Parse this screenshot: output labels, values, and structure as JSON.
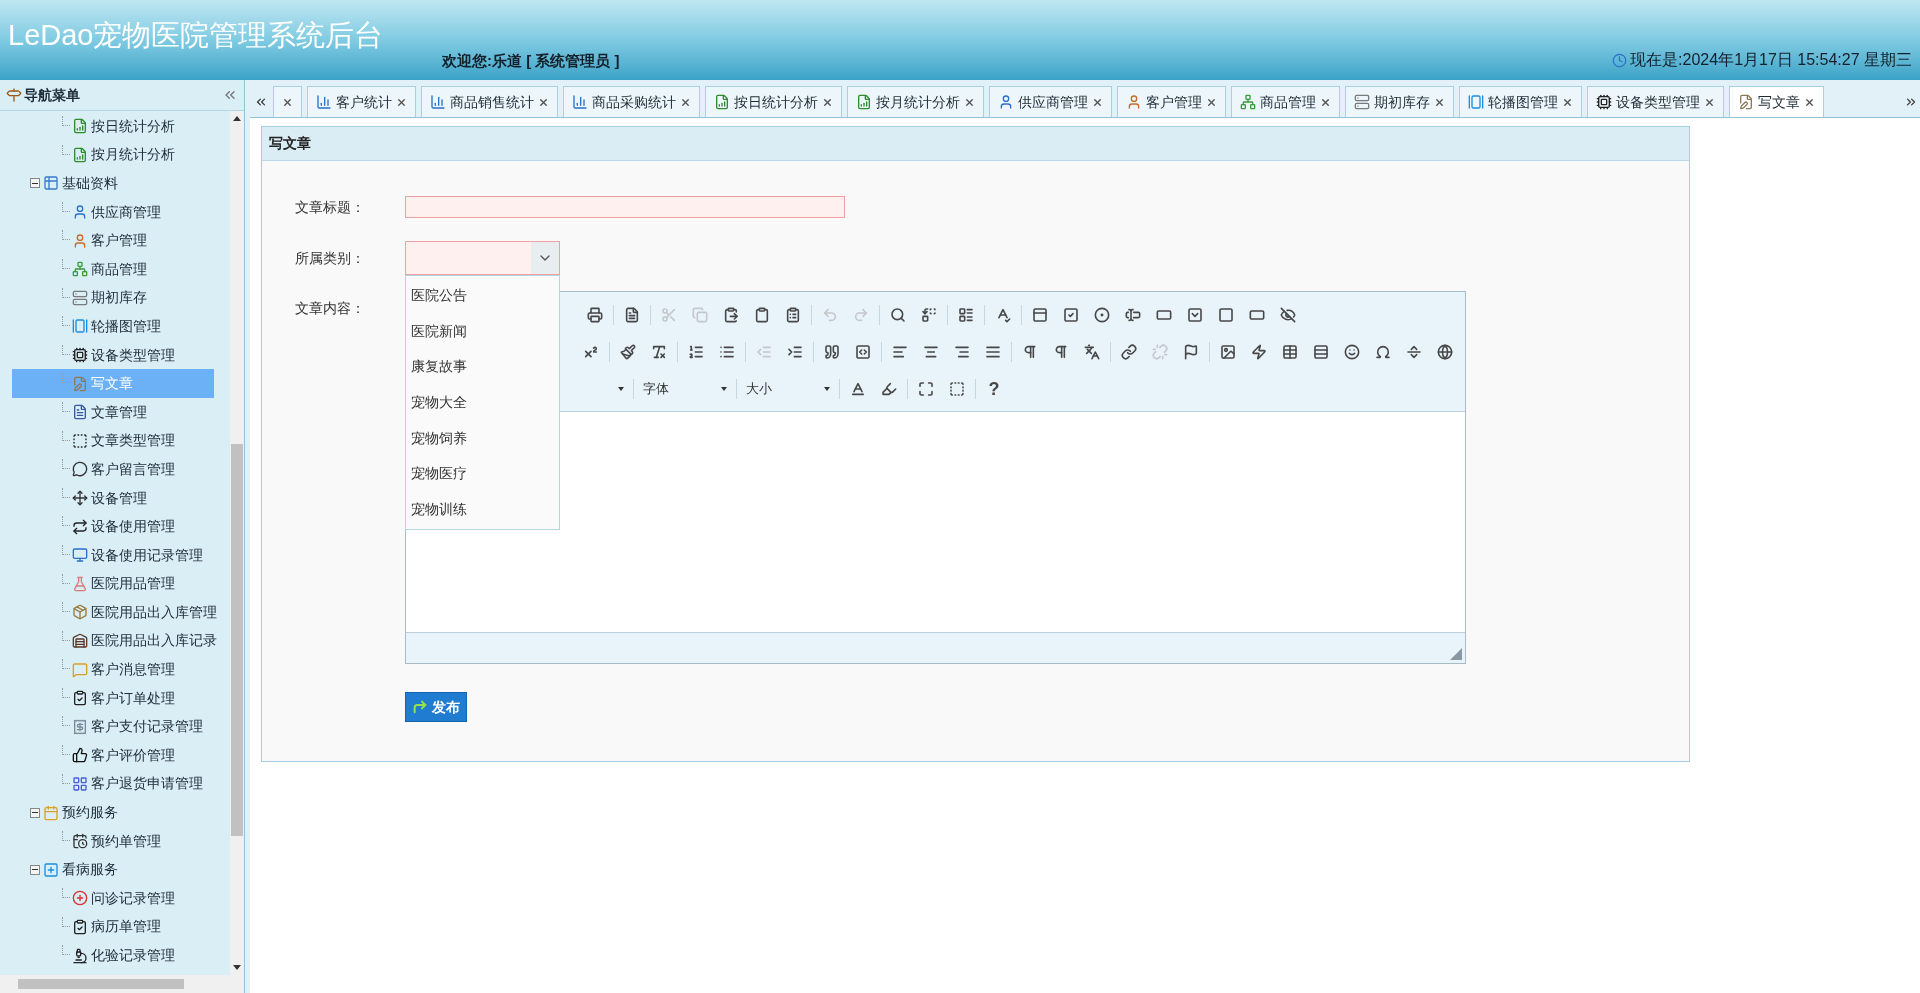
{
  "header": {
    "title": "LeDao宠物医院管理系统后台",
    "welcome": "欢迎您:乐道 [ 系统管理员 ]",
    "clock": "现在是:2024年1月17日 15:54:27 星期三"
  },
  "sidebar": {
    "title": "导航菜单",
    "items": [
      {
        "children": [
          {
            "label": "按日统计分析",
            "selected": false
          },
          {
            "label": "按月统计分析",
            "selected": false
          }
        ]
      },
      {
        "label": "基础资料",
        "expanded": true,
        "children": [
          {
            "label": "供应商管理",
            "selected": false
          },
          {
            "label": "客户管理",
            "selected": false
          },
          {
            "label": "商品管理",
            "selected": false
          },
          {
            "label": "期初库存",
            "selected": false
          },
          {
            "label": "轮播图管理",
            "selected": false
          },
          {
            "label": "设备类型管理",
            "selected": false
          },
          {
            "label": "写文章",
            "selected": true
          },
          {
            "label": "文章管理",
            "selected": false
          },
          {
            "label": "文章类型管理",
            "selected": false
          },
          {
            "label": "客户留言管理",
            "selected": false
          },
          {
            "label": "设备管理",
            "selected": false
          },
          {
            "label": "设备使用管理",
            "selected": false
          },
          {
            "label": "设备使用记录管理",
            "selected": false
          },
          {
            "label": "医院用品管理",
            "selected": false
          },
          {
            "label": "医院用品出入库管理",
            "selected": false
          },
          {
            "label": "医院用品出入库记录",
            "selected": false
          },
          {
            "label": "客户消息管理",
            "selected": false
          },
          {
            "label": "客户订单处理",
            "selected": false
          },
          {
            "label": "客户支付记录管理",
            "selected": false
          },
          {
            "label": "客户评价管理",
            "selected": false
          },
          {
            "label": "客户退货申请管理",
            "selected": false
          }
        ]
      },
      {
        "label": "预约服务",
        "expanded": true,
        "children": [
          {
            "label": "预约单管理",
            "selected": false
          }
        ]
      },
      {
        "label": "看病服务",
        "expanded": true,
        "children": [
          {
            "label": "问诊记录管理",
            "selected": false
          },
          {
            "label": "病历单管理",
            "selected": false
          },
          {
            "label": "化验记录管理",
            "selected": false
          }
        ]
      }
    ]
  },
  "tabs": [
    {
      "selected": false
    },
    {
      "label": "客户统计",
      "selected": false
    },
    {
      "label": "商品销售统计",
      "selected": false
    },
    {
      "label": "商品采购统计",
      "selected": false
    },
    {
      "label": "按日统计分析",
      "selected": false
    },
    {
      "label": "按月统计分析",
      "selected": false
    },
    {
      "label": "供应商管理",
      "selected": false
    },
    {
      "label": "客户管理",
      "selected": false
    },
    {
      "label": "商品管理",
      "selected": false
    },
    {
      "label": "期初库存",
      "selected": false
    },
    {
      "label": "轮播图管理",
      "selected": false
    },
    {
      "label": "设备类型管理",
      "selected": false
    },
    {
      "label": "写文章",
      "selected": true
    }
  ],
  "panel": {
    "title": "写文章",
    "fields": [
      {
        "kind": "text",
        "label": "文章标题：",
        "invalid": true
      },
      {
        "kind": "select",
        "label": "所属类别：",
        "invalid": true,
        "expanded": true,
        "options": [
          {
            "label": "医院公告",
            "selected": false
          },
          {
            "label": "医院新闻",
            "selected": false
          },
          {
            "label": "康复故事",
            "selected": false
          },
          {
            "label": "宠物大全",
            "selected": false
          },
          {
            "label": "宠物饲养",
            "selected": false
          },
          {
            "label": "宠物医疗",
            "selected": false
          },
          {
            "label": "宠物训练",
            "selected": false
          }
        ]
      },
      {
        "kind": "editor",
        "label": "文章内容："
      }
    ],
    "toolbar": [
      [
        {
          "kind": "button",
          "disabled": false
        },
        {
          "kind": "separator"
        },
        {
          "kind": "button",
          "disabled": false
        },
        {
          "kind": "separator"
        },
        {
          "kind": "button",
          "disabled": true
        },
        {
          "kind": "button",
          "disabled": true
        },
        {
          "kind": "button",
          "disabled": false
        },
        {
          "kind": "button",
          "disabled": false
        },
        {
          "kind": "button",
          "disabled": false
        },
        {
          "kind": "separator"
        },
        {
          "kind": "button",
          "disabled": true
        },
        {
          "kind": "button",
          "disabled": true
        },
        {
          "kind": "separator"
        },
        {
          "kind": "button",
          "disabled": false
        },
        {
          "kind": "button",
          "disabled": false
        },
        {
          "kind": "separator"
        },
        {
          "kind": "button",
          "disabled": false
        },
        {
          "kind": "separator"
        },
        {
          "kind": "button",
          "disabled": false
        },
        {
          "kind": "separator"
        },
        {
          "kind": "button",
          "disabled": false
        },
        {
          "kind": "button",
          "disabled": false
        },
        {
          "kind": "button",
          "disabled": false
        },
        {
          "kind": "button",
          "disabled": false
        },
        {
          "kind": "button",
          "disabled": false
        },
        {
          "kind": "button",
          "disabled": false
        },
        {
          "kind": "button",
          "disabled": false
        },
        {
          "kind": "button",
          "disabled": false
        },
        {
          "kind": "button",
          "disabled": false
        }
      ],
      [
        {
          "kind": "button",
          "disabled": false
        },
        {
          "kind": "separator"
        },
        {
          "kind": "button",
          "disabled": false
        },
        {
          "kind": "button",
          "disabled": false
        },
        {
          "kind": "separator"
        },
        {
          "kind": "button",
          "disabled": false
        },
        {
          "kind": "button",
          "disabled": false
        },
        {
          "kind": "separator"
        },
        {
          "kind": "button",
          "disabled": true
        },
        {
          "kind": "button",
          "disabled": false
        },
        {
          "kind": "separator"
        },
        {
          "kind": "button",
          "disabled": false
        },
        {
          "kind": "button",
          "disabled": false
        },
        {
          "kind": "separator"
        },
        {
          "kind": "button",
          "disabled": false
        },
        {
          "kind": "button",
          "disabled": false
        },
        {
          "kind": "button",
          "disabled": false
        },
        {
          "kind": "button",
          "disabled": false
        },
        {
          "kind": "separator"
        },
        {
          "kind": "button",
          "disabled": false
        },
        {
          "kind": "button",
          "disabled": false
        },
        {
          "kind": "button",
          "disabled": false
        },
        {
          "kind": "separator"
        },
        {
          "kind": "button",
          "disabled": false
        },
        {
          "kind": "button",
          "disabled": true
        },
        {
          "kind": "button",
          "disabled": false
        },
        {
          "kind": "separator"
        },
        {
          "kind": "button",
          "disabled": false
        },
        {
          "kind": "button",
          "disabled": false
        },
        {
          "kind": "button",
          "disabled": false
        },
        {
          "kind": "button",
          "disabled": false
        },
        {
          "kind": "button",
          "disabled": false
        },
        {
          "kind": "button",
          "disabled": false
        },
        {
          "kind": "button",
          "disabled": false
        },
        {
          "kind": "button",
          "disabled": false
        }
      ],
      [
        {
          "kind": "combo"
        },
        {
          "kind": "separator"
        },
        {
          "kind": "combo",
          "label": "字体"
        },
        {
          "kind": "separator"
        },
        {
          "kind": "combo",
          "label": "大小"
        },
        {
          "kind": "separator"
        },
        {
          "kind": "button",
          "disabled": false
        },
        {
          "kind": "button",
          "disabled": false
        },
        {
          "kind": "separator"
        },
        {
          "kind": "button",
          "disabled": false
        },
        {
          "kind": "button",
          "disabled": false
        },
        {
          "kind": "separator"
        },
        {
          "kind": "text",
          "label": "?"
        }
      ]
    ],
    "submit": "发布"
  }
}
